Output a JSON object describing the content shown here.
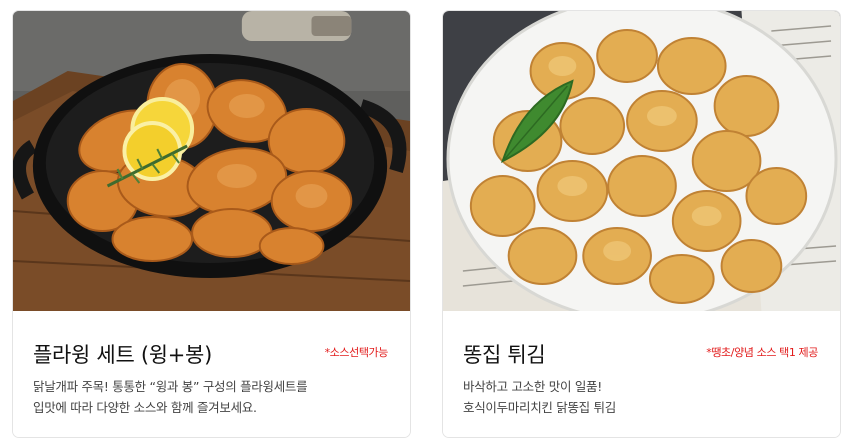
{
  "products": [
    {
      "title": "플라윙 세트 (윙+봉)",
      "note": "*소스선택가능",
      "description": [
        "닭날개파 주목! 통통한 “윙과 봉” 구성의 플라윙세트를",
        "입맛에 따라 다양한 소스와 함께 즐겨보세요."
      ]
    },
    {
      "title": "똥집 튀김",
      "note": "*땡초/양념 소스 택1 제공",
      "description": [
        "바삭하고 고소한 맛이 일품!",
        "호식이두마리치킨 닭똥집 튀김"
      ]
    }
  ]
}
